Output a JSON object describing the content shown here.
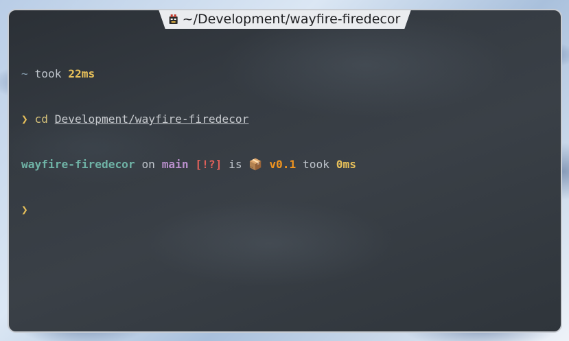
{
  "window": {
    "title": "~/Development/wayfire-firedecor",
    "app_icon": "terminal-app-icon"
  },
  "terminal": {
    "line1": {
      "tilde": "~",
      "took": "took",
      "duration": "22ms"
    },
    "line2": {
      "prompt": "❯",
      "command": "cd",
      "argument": "Development/wayfire-firedecor"
    },
    "line3": {
      "directory": "wayfire-firedecor",
      "on": "on",
      "branch_icon": "",
      "branch": "main",
      "git_status": "[!?]",
      "is": "is",
      "package_icon": "📦",
      "version": "v0.1",
      "took": "took",
      "duration": "0ms"
    },
    "line4": {
      "prompt": "❯"
    }
  },
  "colors": {
    "prompt_yellow": "#e8c15a",
    "directory_teal": "#6fb3a6",
    "branch_purple": "#b98fcc",
    "status_red": "#e0605a",
    "version_orange": "#f0941f"
  }
}
